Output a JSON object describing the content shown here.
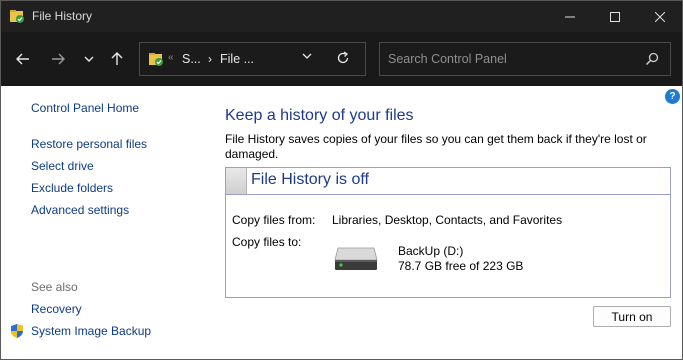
{
  "window": {
    "title": "File History",
    "icon": "file-history-icon"
  },
  "nav": {
    "back_icon": "back-arrow-icon",
    "forward_icon": "forward-arrow-icon",
    "recent_icon": "chevron-down-icon",
    "up_icon": "up-arrow-icon",
    "address": {
      "overflow": "«",
      "crumbs": [
        "S...",
        "File ..."
      ],
      "separator": "›"
    },
    "search_placeholder": "Search Control Panel"
  },
  "sidebar": {
    "home": "Control Panel Home",
    "links": [
      "Restore personal files",
      "Select drive",
      "Exclude folders",
      "Advanced settings"
    ],
    "see_also_label": "See also",
    "see_also": [
      "Recovery",
      "System Image Backup"
    ]
  },
  "main": {
    "help": "?",
    "heading": "Keep a history of your files",
    "description": "File History saves copies of your files so you can get them back if they're lost or damaged.",
    "status_title": "File History is off",
    "copy_from_label": "Copy files from:",
    "copy_from_value": "Libraries, Desktop, Contacts, and Favorites",
    "copy_to_label": "Copy files to:",
    "drive_name": "BackUp (D:)",
    "drive_free": "78.7 GB free of 223 GB",
    "turn_on_label": "Turn on"
  },
  "colors": {
    "titlebar": "#202020",
    "navbar": "#191919",
    "link": "#0d3b85",
    "heading": "#1e3a8a",
    "box_border": "#9aa0c8"
  }
}
